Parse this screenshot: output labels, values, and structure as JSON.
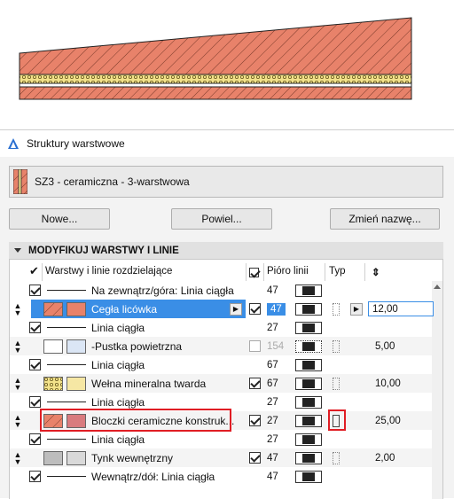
{
  "colors": {
    "brick": "#e8826a",
    "insulation": "#f6e7a4",
    "air": "#dbe6f5",
    "block": "#d97b7e",
    "plaster": "#d9d9d9",
    "selection": "#3a8ee6",
    "highlight": "#e01d24"
  },
  "dialog": {
    "title": "Struktury warstwowe",
    "structure_name": "SZ3 - ceramiczna - 3-warstwowa",
    "buttons": {
      "new": "Nowe...",
      "duplicate": "Powiel...",
      "rename": "Zmień nazwę..."
    },
    "section_title": "MODYFIKUJ WARSTWY I LINIE"
  },
  "table": {
    "headers": {
      "name": "Warstwy i linie rozdzielające",
      "pen": "Pióro linii",
      "type": "Typ",
      "thickness_icon": "thickness-icon"
    },
    "rows": [
      {
        "kind": "line",
        "label": "Na zewnątrz/góra: Linia ciągła",
        "pen": "47"
      },
      {
        "kind": "layer",
        "label": "Cegła licówka",
        "pen": "47",
        "thickness": "12,00",
        "selected": true,
        "fill": "brick",
        "check": true
      },
      {
        "kind": "line",
        "label": "Linia ciągła",
        "pen": "27"
      },
      {
        "kind": "layer",
        "label": "-Pustka powietrzna",
        "pen": "154",
        "thickness": "5,00",
        "fill": "air",
        "check": false
      },
      {
        "kind": "line",
        "label": "Linia ciągła",
        "pen": "67"
      },
      {
        "kind": "layer",
        "label": "Wełna mineralna twarda",
        "pen": "67",
        "thickness": "10,00",
        "fill": "insulation",
        "check": true
      },
      {
        "kind": "line",
        "label": "Linia ciągła",
        "pen": "27"
      },
      {
        "kind": "layer",
        "label": "Bloczki ceramiczne konstruk...",
        "pen": "27",
        "thickness": "25,00",
        "fill": "block",
        "check": true,
        "highlighted": true
      },
      {
        "kind": "line",
        "label": "Linia ciągła",
        "pen": "27"
      },
      {
        "kind": "layer",
        "label": "Tynk wewnętrzny",
        "pen": "47",
        "thickness": "2,00",
        "fill": "plaster",
        "check": true
      },
      {
        "kind": "line",
        "label": "Wewnątrz/dół: Linia ciągła",
        "pen": "47"
      }
    ]
  }
}
